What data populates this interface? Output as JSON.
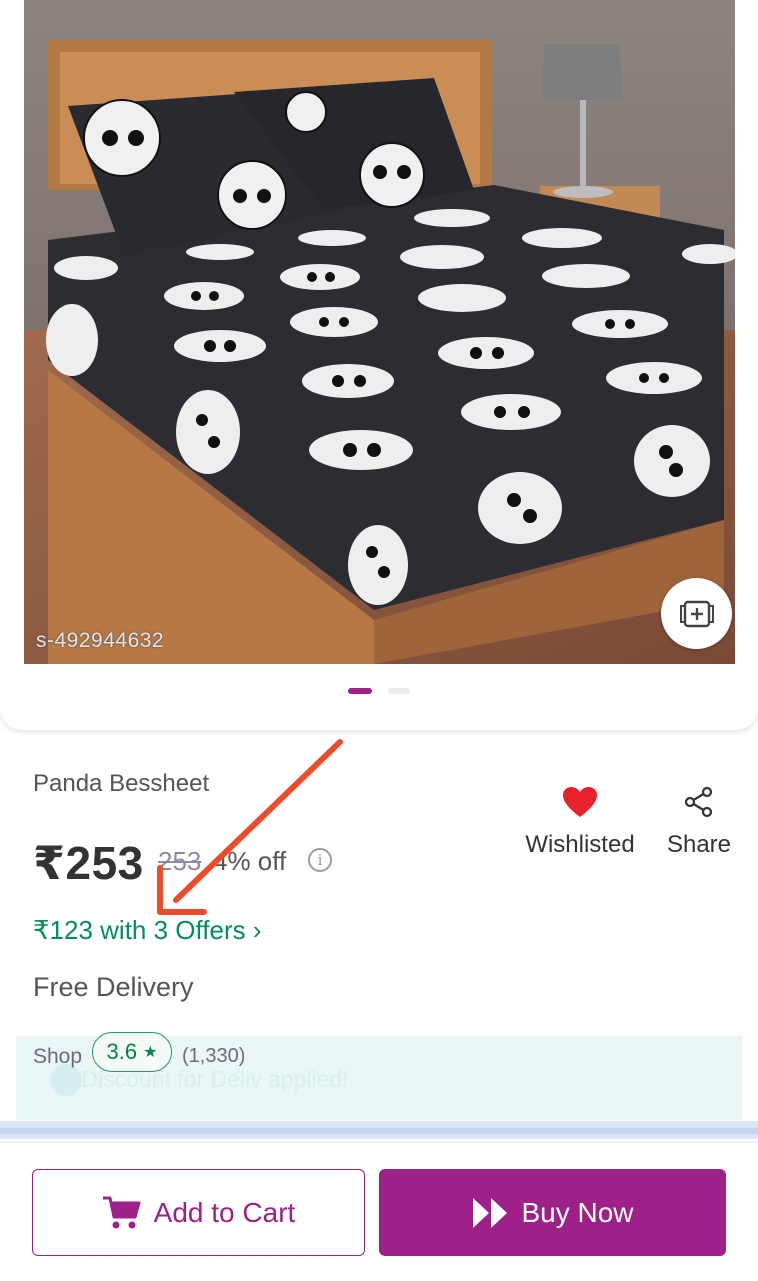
{
  "product": {
    "image_watermark": "s-492944632",
    "title": "Panda Bessheet",
    "price": "₹253",
    "mrp": "253",
    "discount": "4% off",
    "offers_text": "₹123 with 3 Offers",
    "delivery": "Free Delivery"
  },
  "carousel": {
    "current_index": 1,
    "total": 2
  },
  "actions": {
    "wishlist_label": "Wishlisted",
    "share_label": "Share"
  },
  "shop": {
    "label": "Shop",
    "rating": "3.6",
    "rating_count": "(1,330)",
    "faded_offer_text": "…  Discount for Deliv applied!"
  },
  "buttons": {
    "add_to_cart": "Add to Cart",
    "buy_now": "Buy Now"
  },
  "colors": {
    "brand": "#9f2089",
    "offer_green": "#038d63",
    "wishlist_red": "#e8222d",
    "annotation_arrow": "#ee4b2b"
  },
  "icons": {
    "zoom": "add-photo-icon",
    "info": "info-icon",
    "wishlist": "heart-icon",
    "share": "share-icon",
    "rating_star": "star-icon",
    "cart": "cart-icon",
    "buy": "fast-forward-icon",
    "offers_chevron": "chevron-right-icon"
  }
}
